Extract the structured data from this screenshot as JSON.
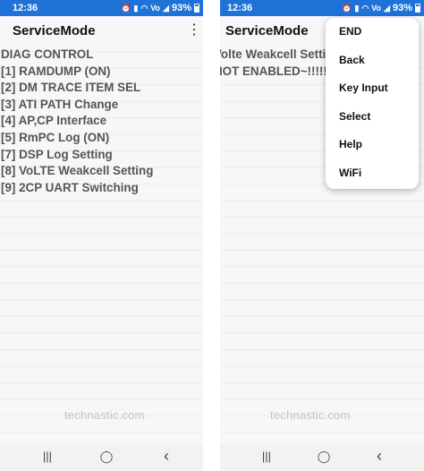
{
  "status_bar": {
    "time": "12:36",
    "battery": "93%",
    "icons": [
      "alarm-icon",
      "vibrate-icon",
      "wifi-icon",
      "volte-icon",
      "signal-icon",
      "battery-icon"
    ]
  },
  "app": {
    "title": "ServiceMode"
  },
  "left_screen": {
    "lines": [
      "DIAG CONTROL",
      "[1] RAMDUMP (ON)",
      "[2] DM TRACE ITEM SEL",
      "[3] ATI PATH Change",
      "[4] AP,CP Interface",
      "[5] RmPC Log (ON)",
      "[7] DSP Log Setting",
      "[8] VoLTE Weakcell Setting",
      "[9] 2CP UART Switching"
    ]
  },
  "right_screen": {
    "lines": [
      "Volte Weakcell Setting",
      "NOT ENABLED~!!!!!"
    ]
  },
  "menu": {
    "items": [
      "END",
      "Back",
      "Key Input",
      "Select",
      "Help",
      "WiFi"
    ]
  },
  "watermark": "technastic.com",
  "nav": {
    "recents": "|||",
    "home": "◯",
    "back": "‹"
  }
}
